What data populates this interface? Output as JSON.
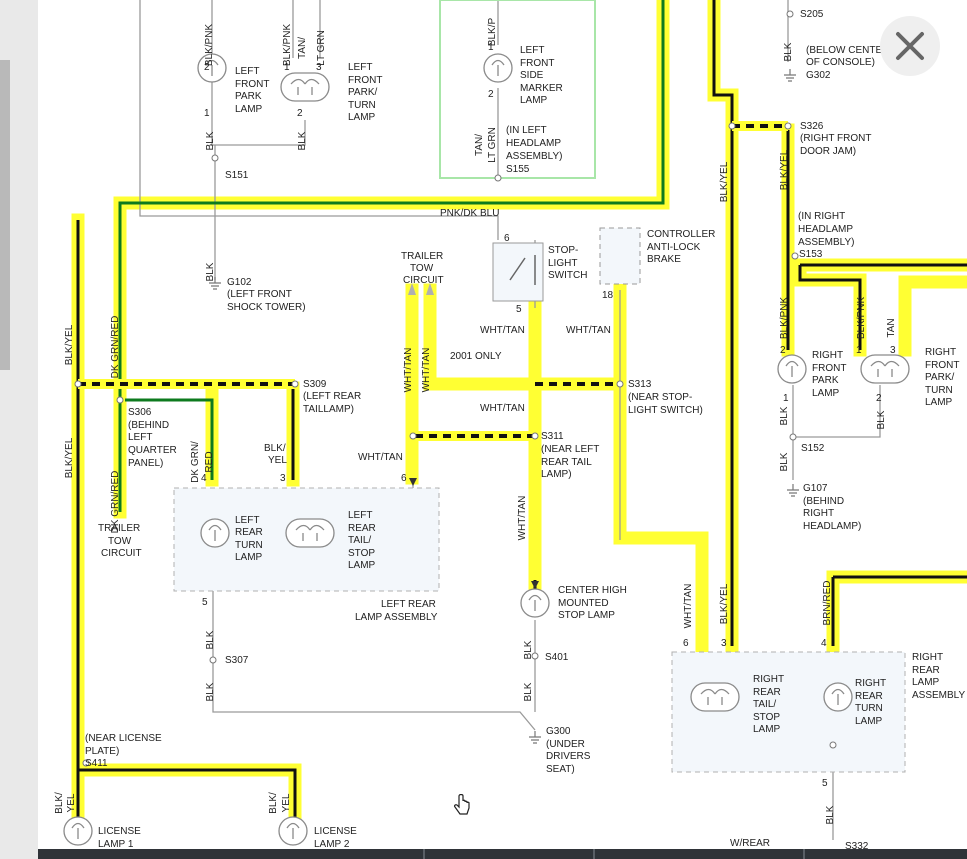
{
  "colors": {
    "highlight": "#ffff33",
    "wire_green": "#0d7a1e",
    "wire_black": "#111111",
    "wire_gray": "#9a9a9a",
    "assembly_fill": "#f3f7fb",
    "assembly_border": "#b0b0b0",
    "headlamp_box": "#a8e6a8"
  },
  "ui": {
    "close_icon": "close-icon"
  },
  "labels": [
    {
      "id": "w_blkpnk_tl",
      "text": "BLK/PNK"
    },
    {
      "id": "w_blkpnk_tl2",
      "text": "BLK/PNK"
    },
    {
      "id": "w_tan_ltgrn_a",
      "text": "TAN/"
    },
    {
      "id": "w_tan_ltgrn_b",
      "text": "LT GRN"
    },
    {
      "id": "p_2a",
      "text": "2"
    },
    {
      "id": "p_1a",
      "text": "1"
    },
    {
      "id": "p_1b",
      "text": "1"
    },
    {
      "id": "p_3a",
      "text": "3"
    },
    {
      "id": "p_2b",
      "text": "2"
    },
    {
      "id": "lfpl_1",
      "text": "LEFT"
    },
    {
      "id": "lfpl_2",
      "text": "FRONT"
    },
    {
      "id": "lfpl_3",
      "text": "PARK"
    },
    {
      "id": "lfpl_4",
      "text": "LAMP"
    },
    {
      "id": "lfpt_1",
      "text": "LEFT"
    },
    {
      "id": "lfpt_2",
      "text": "FRONT"
    },
    {
      "id": "lfpt_3",
      "text": "PARK/"
    },
    {
      "id": "lfpt_4",
      "text": "TURN"
    },
    {
      "id": "lfpt_5",
      "text": "LAMP"
    },
    {
      "id": "w_blk_a",
      "text": "BLK"
    },
    {
      "id": "w_blk_b",
      "text": "BLK"
    },
    {
      "id": "s151",
      "text": "S151"
    },
    {
      "id": "w_blkp_top",
      "text": "BLK/P"
    },
    {
      "id": "p_1c",
      "text": "1"
    },
    {
      "id": "p_2c",
      "text": "2"
    },
    {
      "id": "lfsm_1",
      "text": "LEFT"
    },
    {
      "id": "lfsm_2",
      "text": "FRONT"
    },
    {
      "id": "lfsm_3",
      "text": "SIDE"
    },
    {
      "id": "lfsm_4",
      "text": "MARKER"
    },
    {
      "id": "lfsm_5",
      "text": "LAMP"
    },
    {
      "id": "w_tan_ltgrn2_a",
      "text": "TAN/"
    },
    {
      "id": "w_tan_ltgrn2_b",
      "text": "LT GRN"
    },
    {
      "id": "ilh_1",
      "text": "(IN LEFT"
    },
    {
      "id": "ilh_2",
      "text": "HEADLAMP"
    },
    {
      "id": "ilh_3",
      "text": "ASSEMBLY)"
    },
    {
      "id": "s155",
      "text": "S155"
    },
    {
      "id": "s205",
      "text": "S205"
    },
    {
      "id": "w_blk_c",
      "text": "BLK"
    },
    {
      "id": "bcc_1",
      "text": "(BELOW CENTER"
    },
    {
      "id": "bcc_2",
      "text": "OF CONSOLE)"
    },
    {
      "id": "g302",
      "text": "G302"
    },
    {
      "id": "s326",
      "text": "S326"
    },
    {
      "id": "rfdj_1",
      "text": "(RIGHT FRONT"
    },
    {
      "id": "rfdj_2",
      "text": "DOOR JAM)"
    },
    {
      "id": "w_blkyel_a",
      "text": "BLK/YEL"
    },
    {
      "id": "w_blkyel_b",
      "text": "BLK/YEL"
    },
    {
      "id": "irh_1",
      "text": "(IN RIGHT"
    },
    {
      "id": "irh_2",
      "text": "HEADLAMP"
    },
    {
      "id": "irh_3",
      "text": "ASSEMBLY)"
    },
    {
      "id": "s153",
      "text": "S153"
    },
    {
      "id": "w_pnkdkblu",
      "text": "PNK/DK BLU"
    },
    {
      "id": "p_6a",
      "text": "6"
    },
    {
      "id": "sls_1",
      "text": "STOP-"
    },
    {
      "id": "sls_2",
      "text": "LIGHT"
    },
    {
      "id": "sls_3",
      "text": "SWITCH"
    },
    {
      "id": "p_5a",
      "text": "5"
    },
    {
      "id": "cab_1",
      "text": "CONTROLLER"
    },
    {
      "id": "cab_2",
      "text": "ANTI-LOCK"
    },
    {
      "id": "cab_3",
      "text": "BRAKE"
    },
    {
      "id": "p_18",
      "text": "18"
    },
    {
      "id": "w_blk_d",
      "text": "BLK"
    },
    {
      "id": "g102",
      "text": "G102"
    },
    {
      "id": "lfst_1",
      "text": "(LEFT FRONT"
    },
    {
      "id": "lfst_2",
      "text": "SHOCK TOWER)"
    },
    {
      "id": "ttc_1",
      "text": "TRAILER"
    },
    {
      "id": "ttc_2",
      "text": "TOW"
    },
    {
      "id": "ttc_3",
      "text": "CIRCUIT"
    },
    {
      "id": "w_whttan_a",
      "text": "WHT/TAN"
    },
    {
      "id": "w_whttan_b",
      "text": "WHT/TAN"
    },
    {
      "id": "w_whttan_c",
      "text": "WHT/TAN"
    },
    {
      "id": "w_whttan_d",
      "text": "WHT/TAN"
    },
    {
      "id": "only2001",
      "text": "2001 ONLY"
    },
    {
      "id": "w_blkyel_c",
      "text": "BLK/YEL"
    },
    {
      "id": "w_blkyel_d",
      "text": "BLK/YEL"
    },
    {
      "id": "w_dkgrnred_a",
      "text": "DK GRN/RED"
    },
    {
      "id": "w_dkgrnred_b",
      "text": "DK GRN/RED"
    },
    {
      "id": "s309",
      "text": "S309"
    },
    {
      "id": "lrt_1",
      "text": "(LEFT REAR"
    },
    {
      "id": "lrt_2",
      "text": "TAILLAMP)"
    },
    {
      "id": "s313",
      "text": "S313"
    },
    {
      "id": "nsls_1",
      "text": "(NEAR STOP-"
    },
    {
      "id": "nsls_2",
      "text": "LIGHT SWITCH)"
    },
    {
      "id": "w_whttan_e",
      "text": "WHT/TAN"
    },
    {
      "id": "s306",
      "text": "S306"
    },
    {
      "id": "blqp_1",
      "text": "(BEHIND"
    },
    {
      "id": "blqp_2",
      "text": "LEFT"
    },
    {
      "id": "blqp_3",
      "text": "QUARTER"
    },
    {
      "id": "blqp_4",
      "text": "PANEL)"
    },
    {
      "id": "w_dkgrn_a",
      "text": "DK GRN/"
    },
    {
      "id": "w_dkgrn_b",
      "text": "RED"
    },
    {
      "id": "w_blkyel2_a",
      "text": "BLK/"
    },
    {
      "id": "w_blkyel2_b",
      "text": "YEL"
    },
    {
      "id": "s311",
      "text": "S311"
    },
    {
      "id": "nlrt_1",
      "text": "(NEAR LEFT"
    },
    {
      "id": "nlrt_2",
      "text": "REAR TAIL"
    },
    {
      "id": "nlrt_3",
      "text": "LAMP)"
    },
    {
      "id": "w_whttan_f",
      "text": "WHT/TAN"
    },
    {
      "id": "w_whttan_g",
      "text": "WHT/TAN"
    },
    {
      "id": "p_4a",
      "text": "4"
    },
    {
      "id": "p_3b",
      "text": "3"
    },
    {
      "id": "p_6b",
      "text": "6"
    },
    {
      "id": "ttc2_1",
      "text": "TRAILER"
    },
    {
      "id": "ttc2_2",
      "text": "TOW"
    },
    {
      "id": "ttc2_3",
      "text": "CIRCUIT"
    },
    {
      "id": "lrtl_1",
      "text": "LEFT"
    },
    {
      "id": "lrtl_2",
      "text": "REAR"
    },
    {
      "id": "lrtl_3",
      "text": "TURN"
    },
    {
      "id": "lrtl_4",
      "text": "LAMP"
    },
    {
      "id": "lrts_1",
      "text": "LEFT"
    },
    {
      "id": "lrts_2",
      "text": "REAR"
    },
    {
      "id": "lrts_3",
      "text": "TAIL/"
    },
    {
      "id": "lrts_4",
      "text": "STOP"
    },
    {
      "id": "lrts_5",
      "text": "LAMP"
    },
    {
      "id": "lrla_1",
      "text": "LEFT REAR"
    },
    {
      "id": "lrla_2",
      "text": "LAMP ASSEMBLY"
    },
    {
      "id": "p_5b",
      "text": "5"
    },
    {
      "id": "w_blk_e",
      "text": "BLK"
    },
    {
      "id": "s307",
      "text": "S307"
    },
    {
      "id": "w_blk_f",
      "text": "BLK"
    },
    {
      "id": "chms_1",
      "text": "CENTER HIGH"
    },
    {
      "id": "chms_2",
      "text": "MOUNTED"
    },
    {
      "id": "chms_3",
      "text": "STOP LAMP"
    },
    {
      "id": "w_blk_g",
      "text": "BLK"
    },
    {
      "id": "s401",
      "text": "S401"
    },
    {
      "id": "w_blk_h",
      "text": "BLK"
    },
    {
      "id": "g300",
      "text": "G300"
    },
    {
      "id": "uds_1",
      "text": "(UNDER"
    },
    {
      "id": "uds_2",
      "text": "DRIVERS"
    },
    {
      "id": "uds_3",
      "text": "SEAT)"
    },
    {
      "id": "nlp_1",
      "text": "(NEAR LICENSE"
    },
    {
      "id": "nlp_2",
      "text": "PLATE)"
    },
    {
      "id": "s411",
      "text": "S411"
    },
    {
      "id": "w_blkyel3_a",
      "text": "BLK/"
    },
    {
      "id": "w_blkyel3_b",
      "text": "YEL"
    },
    {
      "id": "w_blkyel4_a",
      "text": "BLK/"
    },
    {
      "id": "w_blkyel4_b",
      "text": "YEL"
    },
    {
      "id": "ll1_1",
      "text": "LICENSE"
    },
    {
      "id": "ll1_2",
      "text": "LAMP 1"
    },
    {
      "id": "ll2_1",
      "text": "LICENSE"
    },
    {
      "id": "ll2_2",
      "text": "LAMP 2"
    },
    {
      "id": "w_blkpnk_r1",
      "text": "BLK/PNK"
    },
    {
      "id": "w_blkpnk_r2",
      "text": "BLK/PNK"
    },
    {
      "id": "w_tan_r",
      "text": "TAN"
    },
    {
      "id": "p_2d",
      "text": "2"
    },
    {
      "id": "p_1d",
      "text": "1"
    },
    {
      "id": "p_3c",
      "text": "3"
    },
    {
      "id": "rfpl_1",
      "text": "RIGHT"
    },
    {
      "id": "rfpl_2",
      "text": "FRONT"
    },
    {
      "id": "rfpl_3",
      "text": "PARK"
    },
    {
      "id": "rfpl_4",
      "text": "LAMP"
    },
    {
      "id": "rfpt_1",
      "text": "RIGHT"
    },
    {
      "id": "rfpt_2",
      "text": "FRONT"
    },
    {
      "id": "rfpt_3",
      "text": "PARK/"
    },
    {
      "id": "rfpt_4",
      "text": "TURN"
    },
    {
      "id": "rfpt_5",
      "text": "LAMP"
    },
    {
      "id": "p_1e",
      "text": "1"
    },
    {
      "id": "p_2e",
      "text": "2"
    },
    {
      "id": "w_blk_i",
      "text": "BLK"
    },
    {
      "id": "w_blk_j",
      "text": "BLK"
    },
    {
      "id": "s152",
      "text": "S152"
    },
    {
      "id": "w_blk_k",
      "text": "BLK"
    },
    {
      "id": "g107",
      "text": "G107"
    },
    {
      "id": "brh_1",
      "text": "(BEHIND"
    },
    {
      "id": "brh_2",
      "text": "RIGHT"
    },
    {
      "id": "brh_3",
      "text": "HEADLAMP)"
    },
    {
      "id": "w_brnred",
      "text": "BRN/RED"
    },
    {
      "id": "w_whttan_h",
      "text": "WHT/TAN"
    },
    {
      "id": "w_blkyel5",
      "text": "BLK/YEL"
    },
    {
      "id": "p_6c",
      "text": "6"
    },
    {
      "id": "p_3d",
      "text": "3"
    },
    {
      "id": "p_4b",
      "text": "4"
    },
    {
      "id": "rrla_1",
      "text": "RIGHT"
    },
    {
      "id": "rrla_2",
      "text": "REAR"
    },
    {
      "id": "rrla_3",
      "text": "LAMP"
    },
    {
      "id": "rrla_4",
      "text": "ASSEMBLY"
    },
    {
      "id": "rrts_1",
      "text": "RIGHT"
    },
    {
      "id": "rrts_2",
      "text": "REAR"
    },
    {
      "id": "rrts_3",
      "text": "TAIL/"
    },
    {
      "id": "rrts_4",
      "text": "STOP"
    },
    {
      "id": "rrts_5",
      "text": "LAMP"
    },
    {
      "id": "rrtl_1",
      "text": "RIGHT"
    },
    {
      "id": "rrtl_2",
      "text": "REAR"
    },
    {
      "id": "rrtl_3",
      "text": "TURN"
    },
    {
      "id": "rrtl_4",
      "text": "LAMP"
    },
    {
      "id": "p_5c",
      "text": "5"
    },
    {
      "id": "w_blk_l",
      "text": "BLK"
    },
    {
      "id": "s332",
      "text": "S332"
    },
    {
      "id": "wrear",
      "text": "W/REAR"
    }
  ]
}
